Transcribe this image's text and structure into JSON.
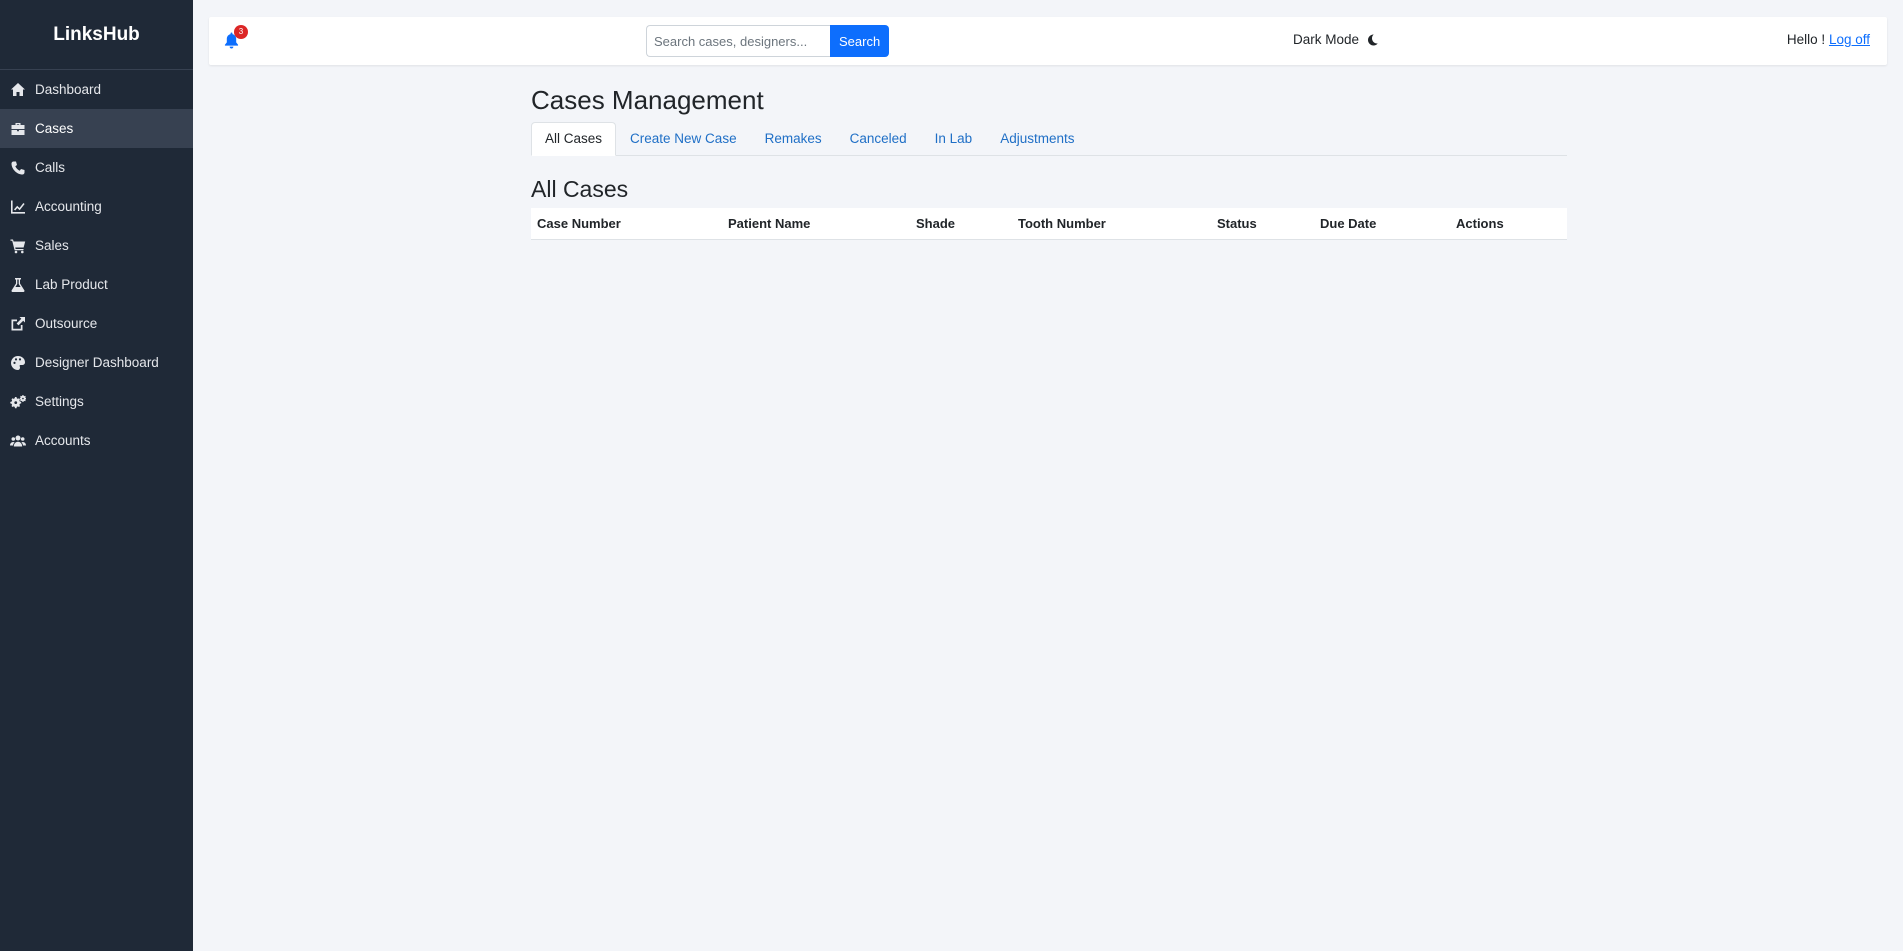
{
  "sidebar": {
    "brand": "LinksHub",
    "items": [
      {
        "label": "Dashboard",
        "icon": "home-icon"
      },
      {
        "label": "Cases",
        "icon": "briefcase-icon",
        "active": true
      },
      {
        "label": "Calls",
        "icon": "phone-icon"
      },
      {
        "label": "Accounting",
        "icon": "chart-line-icon"
      },
      {
        "label": "Sales",
        "icon": "cart-icon"
      },
      {
        "label": "Lab Product",
        "icon": "flask-icon"
      },
      {
        "label": "Outsource",
        "icon": "external-link-icon"
      },
      {
        "label": "Designer Dashboard",
        "icon": "palette-icon"
      },
      {
        "label": "Settings",
        "icon": "gears-icon"
      },
      {
        "label": "Accounts",
        "icon": "users-icon"
      }
    ]
  },
  "topbar": {
    "notification_count": "3",
    "search_placeholder": "Search cases, designers...",
    "search_button": "Search",
    "dark_mode_label": "Dark Mode",
    "greeting": "Hello !",
    "logoff_label": "Log off"
  },
  "main": {
    "title": "Cases Management",
    "tabs": [
      {
        "label": "All Cases",
        "active": true
      },
      {
        "label": "Create New Case"
      },
      {
        "label": "Remakes"
      },
      {
        "label": "Canceled"
      },
      {
        "label": "In Lab"
      },
      {
        "label": "Adjustments"
      }
    ],
    "section_title": "All Cases",
    "table": {
      "columns": [
        "Case Number",
        "Patient Name",
        "Shade",
        "Tooth Number",
        "Status",
        "Due Date",
        "Actions"
      ],
      "rows": []
    }
  },
  "colors": {
    "sidebar_bg": "#1f2937",
    "accent": "#0d6efd",
    "badge": "#dc2626",
    "page_bg": "#f3f5f9"
  }
}
